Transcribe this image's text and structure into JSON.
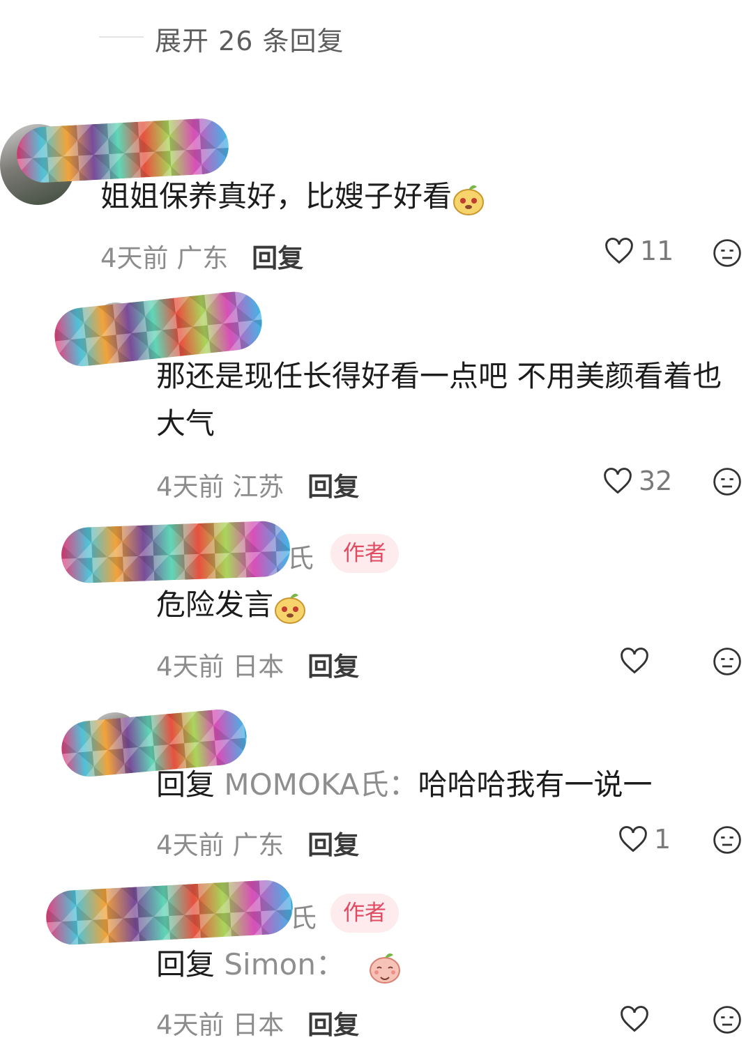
{
  "thread": {
    "expand_label": "展开 26 条回复"
  },
  "comments": [
    {
      "name_tail": "",
      "is_author": false,
      "author_tag": "",
      "text": "姐姐保养真好，比嫂子好看",
      "emoji": "peach-face-emoji",
      "time": "4天前",
      "location": "广东",
      "reply_label": "回复",
      "likes": "11"
    },
    {
      "name_tail": "",
      "is_author": false,
      "author_tag": "",
      "text_line1": "那还是现任长得好看一点吧 不用美颜看着也",
      "text_line2": "大气",
      "time": "4天前",
      "location": "江苏",
      "reply_label": "回复",
      "likes": "32"
    },
    {
      "name_tail": "氏",
      "is_author": true,
      "author_tag": "作者",
      "text": "危险发言",
      "emoji": "peach-face-emoji",
      "time": "4天前",
      "location": "日本",
      "reply_label": "回复",
      "likes": ""
    },
    {
      "name_tail": "",
      "is_author": false,
      "author_tag": "",
      "reply_prefix": "回复",
      "mention": "MOMOKA氏：",
      "text": "哈哈哈我有一说一",
      "time": "4天前",
      "location": "广东",
      "reply_label": "回复",
      "likes": "1"
    },
    {
      "name_tail": "氏",
      "is_author": true,
      "author_tag": "作者",
      "reply_prefix": "回复",
      "mention": "Simon：",
      "emoji": "shy-peach-emoji",
      "time": "4天前",
      "location": "日本",
      "reply_label": "回复",
      "likes": ""
    }
  ],
  "icons": {
    "like": "heart-outline-icon",
    "dislike": "meh-face-icon"
  },
  "colors": {
    "author_tag_bg": "#fdebee",
    "author_tag_text": "#e14b62",
    "meta_text": "#8c8c8c"
  }
}
